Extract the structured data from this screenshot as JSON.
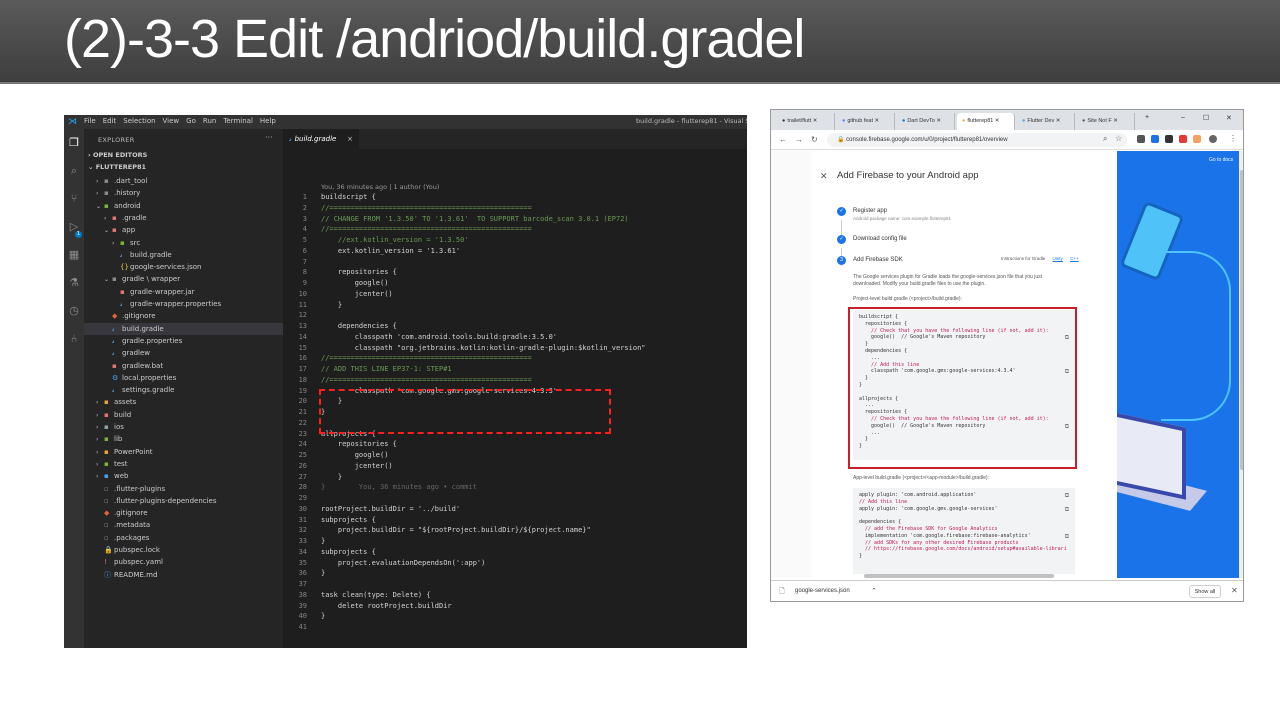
{
  "slide": {
    "title": "(2)-3-3 Edit /andriod/build.gradel"
  },
  "vscode": {
    "menu": [
      "File",
      "Edit",
      "Selection",
      "View",
      "Go",
      "Run",
      "Terminal",
      "Help"
    ],
    "window_title": "build.gradle - flutterep81 - Visual Stu",
    "explorer_title": "EXPLORER",
    "open_editors": "OPEN EDITORS",
    "project": "FLUTTEREP81",
    "badge": "1",
    "tree": [
      {
        "depth": 1,
        "chev": "›",
        "icon": "▪",
        "color": "#8a8a8a",
        "label": ".dart_tool"
      },
      {
        "depth": 1,
        "chev": "›",
        "icon": "▪",
        "color": "#8a8a8a",
        "label": ".history"
      },
      {
        "depth": 1,
        "chev": "⌄",
        "icon": "▪",
        "color": "#7cb342",
        "label": "android"
      },
      {
        "depth": 2,
        "chev": "›",
        "icon": "▪",
        "color": "#e57373",
        "label": ".gradle"
      },
      {
        "depth": 2,
        "chev": "⌄",
        "icon": "▪",
        "color": "#e57373",
        "label": "app"
      },
      {
        "depth": 3,
        "chev": "›",
        "icon": "▪",
        "color": "#7cb342",
        "label": "src"
      },
      {
        "depth": 3,
        "chev": "",
        "icon": "𝓈",
        "color": "#5aa0e8",
        "label": "build.gradle"
      },
      {
        "depth": 3,
        "chev": "",
        "icon": "{}",
        "color": "#e6c84a",
        "label": "google-services.json"
      },
      {
        "depth": 2,
        "chev": "⌄",
        "icon": "▪",
        "color": "#8a8a8a",
        "label": "gradle \\ wrapper"
      },
      {
        "depth": 3,
        "chev": "",
        "icon": "▪",
        "color": "#e57373",
        "label": "gradle-wrapper.jar"
      },
      {
        "depth": 3,
        "chev": "",
        "icon": "𝓈",
        "color": "#5aa0e8",
        "label": "gradle-wrapper.properties"
      },
      {
        "depth": 2,
        "chev": "",
        "icon": "◆",
        "color": "#e0643c",
        "label": ".gitignore"
      },
      {
        "depth": 2,
        "chev": "",
        "icon": "𝓈",
        "color": "#5aa0e8",
        "label": "build.gradle",
        "sel": true
      },
      {
        "depth": 2,
        "chev": "",
        "icon": "𝓈",
        "color": "#5aa0e8",
        "label": "gradle.properties"
      },
      {
        "depth": 2,
        "chev": "",
        "icon": "𝓈",
        "color": "#5aa0e8",
        "label": "gradlew"
      },
      {
        "depth": 2,
        "chev": "",
        "icon": "▪",
        "color": "#e57373",
        "label": "gradlew.bat"
      },
      {
        "depth": 2,
        "chev": "",
        "icon": "⚙",
        "color": "#42a5f5",
        "label": "local.properties"
      },
      {
        "depth": 2,
        "chev": "",
        "icon": "𝓈",
        "color": "#5aa0e8",
        "label": "settings.gradle"
      },
      {
        "depth": 1,
        "chev": "›",
        "icon": "▪",
        "color": "#e6a23c",
        "label": "assets"
      },
      {
        "depth": 1,
        "chev": "›",
        "icon": "▪",
        "color": "#e57373",
        "label": "build"
      },
      {
        "depth": 1,
        "chev": "›",
        "icon": "▪",
        "color": "#90a4ae",
        "label": "ios"
      },
      {
        "depth": 1,
        "chev": "›",
        "icon": "▪",
        "color": "#7cb342",
        "label": "lib"
      },
      {
        "depth": 1,
        "chev": "›",
        "icon": "▪",
        "color": "#e6a23c",
        "label": "PowerPoint"
      },
      {
        "depth": 1,
        "chev": "›",
        "icon": "▪",
        "color": "#7cb342",
        "label": "test"
      },
      {
        "depth": 1,
        "chev": "›",
        "icon": "▪",
        "color": "#42a5f5",
        "label": "web"
      },
      {
        "depth": 1,
        "chev": "",
        "icon": "▫",
        "color": "#8a8a8a",
        "label": ".flutter-plugins"
      },
      {
        "depth": 1,
        "chev": "",
        "icon": "▫",
        "color": "#8a8a8a",
        "label": ".flutter-plugins-dependencies"
      },
      {
        "depth": 1,
        "chev": "",
        "icon": "◆",
        "color": "#e0643c",
        "label": ".gitignore"
      },
      {
        "depth": 1,
        "chev": "",
        "icon": "▫",
        "color": "#8a8a8a",
        "label": ".metadata"
      },
      {
        "depth": 1,
        "chev": "",
        "icon": "▫",
        "color": "#8a8a8a",
        "label": ".packages"
      },
      {
        "depth": 1,
        "chev": "",
        "icon": "🔒",
        "color": "#e6c84a",
        "label": "pubspec.lock"
      },
      {
        "depth": 1,
        "chev": "",
        "icon": "!",
        "color": "#e57373",
        "label": "pubspec.yaml"
      },
      {
        "depth": 1,
        "chev": "",
        "icon": "ⓘ",
        "color": "#42a5f5",
        "label": "README.md"
      }
    ],
    "tab_label": "build.gradle",
    "blame": "You, 36 minutes ago | 1 author (You)",
    "code": [
      {
        "n": "1",
        "t": "buildscript {",
        "c": ""
      },
      {
        "n": "2",
        "t": "//================================================",
        "c": "com"
      },
      {
        "n": "3",
        "t": "// CHANGE FROM '1.3.50' TO '1.3.61'  TO SUPPORT barcode_scan 3.0.1 (EP72)",
        "c": "com"
      },
      {
        "n": "4",
        "t": "//================================================",
        "c": "com"
      },
      {
        "n": "5",
        "t": "    //ext.kotlin_version = '1.3.50'",
        "c": "com"
      },
      {
        "n": "6",
        "t": "    ext.kotlin_version = '1.3.61'",
        "c": ""
      },
      {
        "n": "7",
        "t": "",
        "c": ""
      },
      {
        "n": "8",
        "t": "    repositories {",
        "c": ""
      },
      {
        "n": "9",
        "t": "        google()",
        "c": ""
      },
      {
        "n": "10",
        "t": "        jcenter()",
        "c": ""
      },
      {
        "n": "11",
        "t": "    }",
        "c": ""
      },
      {
        "n": "12",
        "t": "",
        "c": ""
      },
      {
        "n": "13",
        "t": "    dependencies {",
        "c": ""
      },
      {
        "n": "14",
        "t": "        classpath 'com.android.tools.build:gradle:3.5.0'",
        "c": ""
      },
      {
        "n": "15",
        "t": "        classpath \"org.jetbrains.kotlin:kotlin-gradle-plugin:$kotlin_version\"",
        "c": ""
      },
      {
        "n": "16",
        "t": "//================================================",
        "c": "com"
      },
      {
        "n": "17",
        "t": "// ADD THIS LINE EP37-1: STEP#1",
        "c": "com"
      },
      {
        "n": "18",
        "t": "//================================================",
        "c": "com"
      },
      {
        "n": "19",
        "t": "        classpath 'com.google.gms:google-services:4.3.3'",
        "c": ""
      },
      {
        "n": "20",
        "t": "    }",
        "c": ""
      },
      {
        "n": "21",
        "t": "}",
        "c": ""
      },
      {
        "n": "22",
        "t": "",
        "c": ""
      },
      {
        "n": "23",
        "t": "allprojects {",
        "c": ""
      },
      {
        "n": "24",
        "t": "    repositories {",
        "c": ""
      },
      {
        "n": "25",
        "t": "        google()",
        "c": ""
      },
      {
        "n": "26",
        "t": "        jcenter()",
        "c": ""
      },
      {
        "n": "27",
        "t": "    }",
        "c": ""
      },
      {
        "n": "28",
        "t": "}        You, 36 minutes ago • commit",
        "c": "ghost"
      },
      {
        "n": "29",
        "t": "",
        "c": ""
      },
      {
        "n": "30",
        "t": "rootProject.buildDir = '../build'",
        "c": ""
      },
      {
        "n": "31",
        "t": "subprojects {",
        "c": ""
      },
      {
        "n": "32",
        "t": "    project.buildDir = \"${rootProject.buildDir}/${project.name}\"",
        "c": ""
      },
      {
        "n": "33",
        "t": "}",
        "c": ""
      },
      {
        "n": "34",
        "t": "subprojects {",
        "c": ""
      },
      {
        "n": "35",
        "t": "    project.evaluationDependsOn(':app')",
        "c": ""
      },
      {
        "n": "36",
        "t": "}",
        "c": ""
      },
      {
        "n": "37",
        "t": "",
        "c": ""
      },
      {
        "n": "38",
        "t": "task clean(type: Delete) {",
        "c": ""
      },
      {
        "n": "39",
        "t": "    delete rootProject.buildDir",
        "c": ""
      },
      {
        "n": "40",
        "t": "}",
        "c": ""
      },
      {
        "n": "41",
        "t": "",
        "c": ""
      }
    ]
  },
  "chrome": {
    "tabs": [
      {
        "label": "trailet/flutt"
      },
      {
        "label": "github feat"
      },
      {
        "label": "Dart DevTo"
      },
      {
        "label": "flutterep81",
        "active": true
      },
      {
        "label": "Flutter Dev"
      },
      {
        "label": "Site Not F"
      }
    ],
    "url": "console.firebase.google.com/u/0/project/flutterep81/overview",
    "goto_docs": "Go to docs",
    "panel_title": "Add Firebase to your Android app",
    "step1_title": "Register app",
    "step1_sub": "Android package name: com.example.flutterep81",
    "step2_title": "Download config file",
    "step3_num": "3",
    "step3_title": "Add Firebase SDK",
    "instructions_label": "Instructions for Gradle",
    "link_unity": "Unity",
    "link_cpp": "C++",
    "desc_line1": "The Google services plugin for Gradle loads the google-services.json file that you just",
    "desc_line2": "downloaded. Modify your build.gradle files to use the plugin.",
    "project_level": "Project-level build.gradle (<project>/build.gradle):",
    "project_code": [
      {
        "t": "buildscript {",
        "c": ""
      },
      {
        "t": "  repositories {",
        "c": ""
      },
      {
        "t": "    // Check that you have the following line (if not, add it):",
        "c": "com"
      },
      {
        "t": "    google()  // Google's Maven repository",
        "c": "mix"
      },
      {
        "t": "  }",
        "c": ""
      },
      {
        "t": "  dependencies {",
        "c": ""
      },
      {
        "t": "    ...",
        "c": ""
      },
      {
        "t": "    // Add this line",
        "c": "com"
      },
      {
        "t": "    classpath 'com.google.gms:google-services:4.3.4'",
        "c": ""
      },
      {
        "t": "  }",
        "c": ""
      },
      {
        "t": "}",
        "c": ""
      },
      {
        "t": "",
        "c": ""
      },
      {
        "t": "allprojects {",
        "c": ""
      },
      {
        "t": "  ...",
        "c": ""
      },
      {
        "t": "  repositories {",
        "c": ""
      },
      {
        "t": "    // Check that you have the following line (if not, add it):",
        "c": "com"
      },
      {
        "t": "    google()  // Google's Maven repository",
        "c": "mix"
      },
      {
        "t": "    ...",
        "c": ""
      },
      {
        "t": "  }",
        "c": ""
      },
      {
        "t": "}",
        "c": ""
      }
    ],
    "app_level": "App-level build.gradle (<project>/<app-module>/build.gradle):",
    "app_code": [
      {
        "t": "apply plugin: 'com.android.application'",
        "c": ""
      },
      {
        "t": "// Add this line",
        "c": "com"
      },
      {
        "t": "apply plugin: 'com.google.gms.google-services'",
        "c": ""
      },
      {
        "t": "",
        "c": ""
      },
      {
        "t": "dependencies {",
        "c": ""
      },
      {
        "t": "  // add the Firebase SDK for Google Analytics",
        "c": "com"
      },
      {
        "t": "  implementation 'com.google.firebase:firebase-analytics'",
        "c": ""
      },
      {
        "t": "  // add SDKs for any other desired Firebase products",
        "c": "com"
      },
      {
        "t": "  // https://firebase.google.com/docs/android/setup#available-librari",
        "c": "com"
      },
      {
        "t": "}",
        "c": ""
      }
    ],
    "download_file": "google-services.json",
    "show_all": "Show all"
  },
  "colors": {
    "highlight_red": "#ff1f1f",
    "firebase_blue": "#1a73e8",
    "vscode_bg": "#1e1e1e"
  }
}
